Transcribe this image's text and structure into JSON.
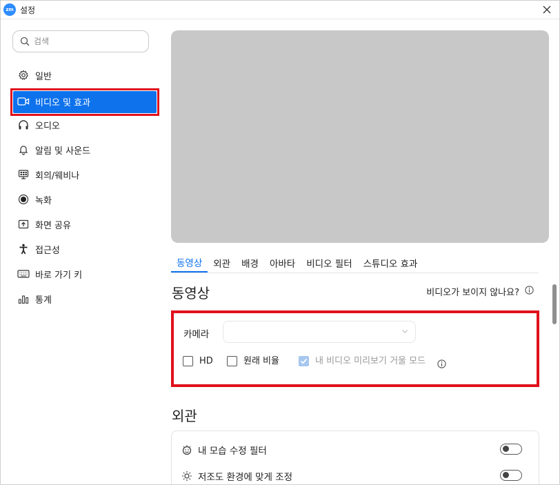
{
  "window": {
    "title": "설정",
    "logo_text": "zm"
  },
  "search": {
    "placeholder": "검색"
  },
  "sidebar": {
    "items": [
      {
        "label": "일반",
        "icon": "gear-icon"
      },
      {
        "label": "비디오 및 효과",
        "icon": "video-camera-icon",
        "active": true
      },
      {
        "label": "오디오",
        "icon": "headphones-icon"
      },
      {
        "label": "알림 및 사운드",
        "icon": "bell-icon"
      },
      {
        "label": "회의/웨비나",
        "icon": "meeting-icon"
      },
      {
        "label": "녹화",
        "icon": "record-icon"
      },
      {
        "label": "화면 공유",
        "icon": "share-screen-icon"
      },
      {
        "label": "접근성",
        "icon": "accessibility-icon"
      },
      {
        "label": "바로 가기 키",
        "icon": "keyboard-icon"
      },
      {
        "label": "통계",
        "icon": "statistics-icon"
      }
    ]
  },
  "tabs": [
    {
      "label": "동영상",
      "active": true
    },
    {
      "label": "외관"
    },
    {
      "label": "배경"
    },
    {
      "label": "아바타"
    },
    {
      "label": "비디오 필터"
    },
    {
      "label": "스튜디오 효과"
    }
  ],
  "video_section": {
    "title": "동영상",
    "help_link": "비디오가 보이지 않나요?",
    "camera_label": "카메라",
    "camera_value": "",
    "checkboxes": [
      {
        "label": "HD",
        "checked": false,
        "disabled": false
      },
      {
        "label": "원래 비율",
        "checked": false,
        "disabled": false
      },
      {
        "label": "내 비디오 미리보기 거울 모드",
        "checked": true,
        "disabled": true
      }
    ]
  },
  "appearance_section": {
    "title": "외관",
    "rows": [
      {
        "label": "내 모습 수정 필터",
        "enabled": false
      },
      {
        "label": "저조도 환경에 맞게 조정",
        "enabled": false
      }
    ]
  },
  "colors": {
    "accent": "#0e72ed",
    "highlight": "#e0101b",
    "preview_bg": "#c8c8c8"
  }
}
